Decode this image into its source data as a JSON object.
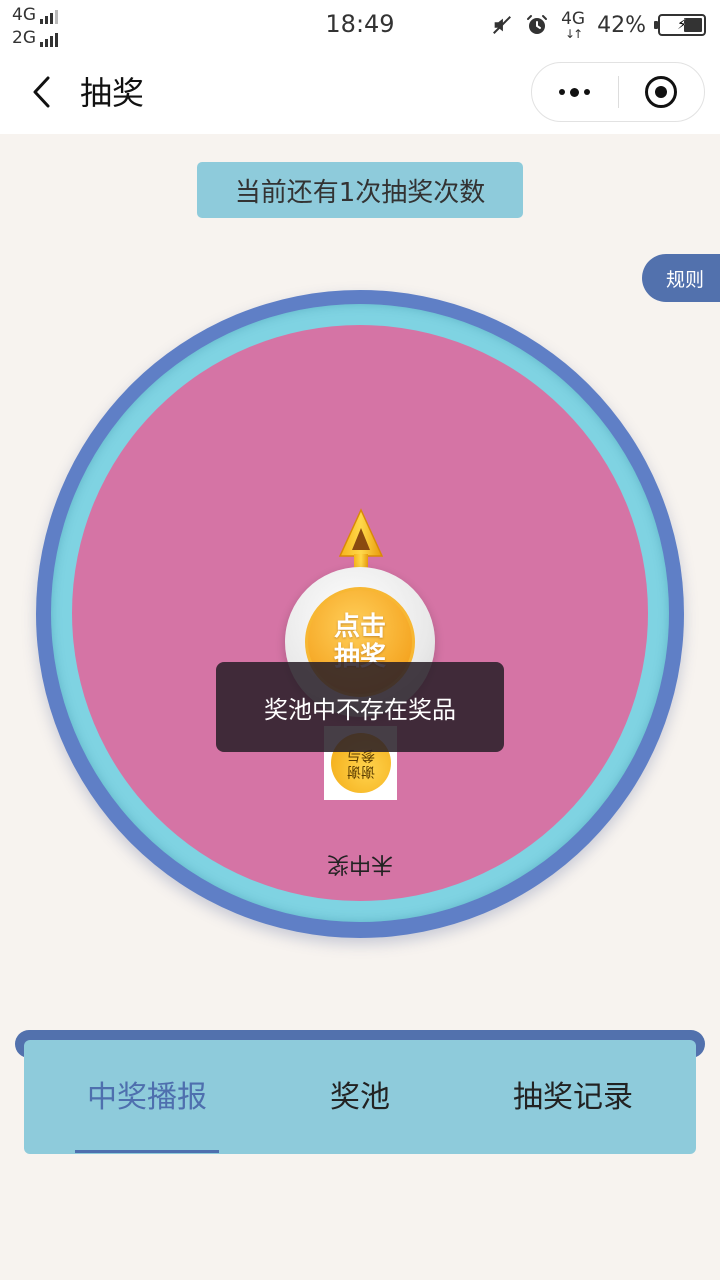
{
  "status_bar": {
    "net1": "4G",
    "net2": "2G",
    "time": "18:49",
    "net_right": "4G",
    "battery": "42%"
  },
  "nav": {
    "title": "抽奖"
  },
  "banner": {
    "chances": "当前还有1次抽奖次数"
  },
  "rules": {
    "label": "规则"
  },
  "wheel": {
    "segment_label": "未中奖",
    "prize_thumb_text": "谢谢参与",
    "start_button_line1": "点击",
    "start_button_line2": "抽奖"
  },
  "toast": {
    "message": "奖池中不存在奖品"
  },
  "tabs": [
    {
      "label": "中奖播报",
      "active": true
    },
    {
      "label": "奖池",
      "active": false
    },
    {
      "label": "抽奖记录",
      "active": false
    }
  ],
  "colors": {
    "wheel_face": "#d574a5",
    "wheel_ring": "#7fd3e2",
    "wheel_outer": "#5f7fc6",
    "accent_blue": "#4e6fae",
    "panel_cyan": "#8ecbdb"
  }
}
